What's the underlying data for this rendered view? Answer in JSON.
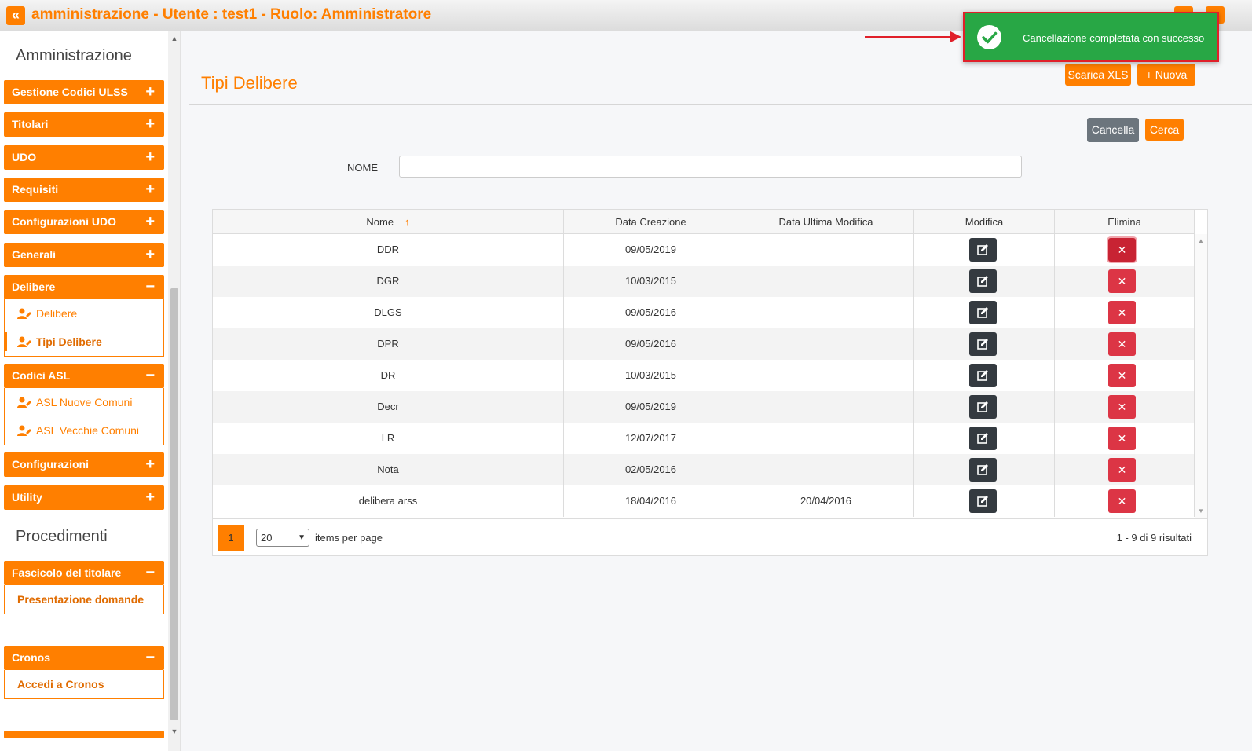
{
  "header": {
    "collapse_glyph": "«",
    "title": "amministrazione - Utente : test1 - Ruolo: Amministratore"
  },
  "sidebar": {
    "section_admin": "Amministrazione",
    "section_proc": "Procedimenti",
    "menus": [
      {
        "label": "Gestione Codici ULSS",
        "sign": "+"
      },
      {
        "label": "Titolari",
        "sign": "+"
      },
      {
        "label": "UDO",
        "sign": "+"
      },
      {
        "label": "Requisiti",
        "sign": "+"
      },
      {
        "label": "Configurazioni UDO",
        "sign": "+"
      },
      {
        "label": "Generali",
        "sign": "+"
      },
      {
        "label": "Delibere",
        "sign": "−"
      },
      {
        "label": "Codici ASL",
        "sign": "−"
      },
      {
        "label": "Configurazioni",
        "sign": "+"
      },
      {
        "label": "Utility",
        "sign": "+"
      },
      {
        "label": "Fascicolo del titolare",
        "sign": "−"
      },
      {
        "label": "Cronos",
        "sign": "−"
      }
    ],
    "delibere_items": [
      "Delibere",
      "Tipi Delibere"
    ],
    "asl_items": [
      "ASL Nuove Comuni",
      "ASL Vecchie Comuni"
    ],
    "fascicolo_items": [
      "Presentazione domande"
    ],
    "cronos_items": [
      "Accedi a Cronos"
    ]
  },
  "main": {
    "page_title": "Tipi Delibere",
    "scarica_label": "Scarica XLS",
    "nuova_label": "+ Nuova",
    "cancella_label": "Cancella",
    "cerca_label": "Cerca",
    "nome_label": "NOME",
    "nome_value": ""
  },
  "grid": {
    "columns": [
      "Nome",
      "Data Creazione",
      "Data Ultima Modifica",
      "Modifica",
      "Elimina"
    ],
    "sort_glyph": "↑",
    "delete_glyph": "✕",
    "rows": [
      {
        "nome": "DDR",
        "creazione": "09/05/2019",
        "modifica": ""
      },
      {
        "nome": "DGR",
        "creazione": "10/03/2015",
        "modifica": ""
      },
      {
        "nome": "DLGS",
        "creazione": "09/05/2016",
        "modifica": ""
      },
      {
        "nome": "DPR",
        "creazione": "09/05/2016",
        "modifica": ""
      },
      {
        "nome": "DR",
        "creazione": "10/03/2015",
        "modifica": ""
      },
      {
        "nome": "Decr",
        "creazione": "09/05/2019",
        "modifica": ""
      },
      {
        "nome": "LR",
        "creazione": "12/07/2017",
        "modifica": ""
      },
      {
        "nome": "Nota",
        "creazione": "02/05/2016",
        "modifica": ""
      },
      {
        "nome": "delibera arss",
        "creazione": "18/04/2016",
        "modifica": "20/04/2016"
      }
    ],
    "pager": {
      "current_page": "1",
      "page_size": "20",
      "per_page_label": "items per page",
      "results": "1 - 9 di 9 risultati"
    }
  },
  "toast": {
    "message": "Cancellazione completata con successo"
  },
  "colors": {
    "accent": "#ff7f00",
    "success": "#28a745",
    "danger": "#dc3545",
    "dark": "#343a40",
    "annotation": "#e0202a"
  }
}
